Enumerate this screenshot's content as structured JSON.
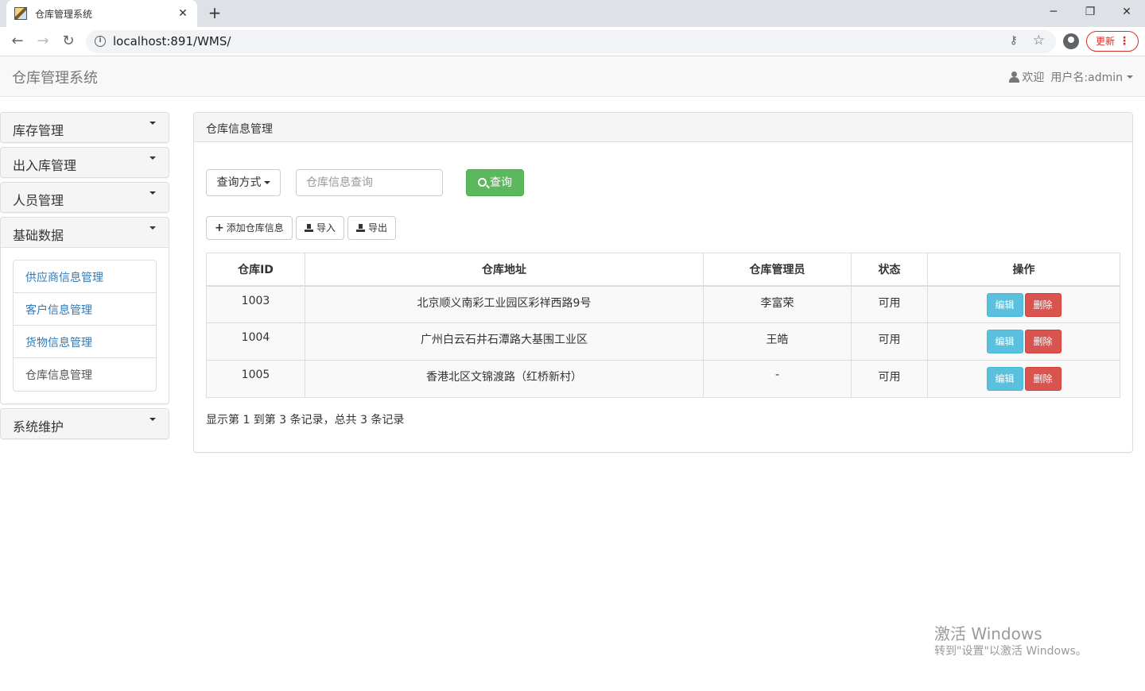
{
  "browser": {
    "tab_title": "仓库管理系统",
    "tab_close": "✕",
    "new_tab": "+",
    "url": "localhost:891/WMS/",
    "update_label": "更新",
    "window_controls": {
      "minimize": "─",
      "restore": "❐",
      "close": "✕"
    }
  },
  "navbar": {
    "brand": "仓库管理系统",
    "welcome": "欢迎",
    "username": "用户名:admin"
  },
  "sidebar": {
    "sections": [
      {
        "label": "库存管理"
      },
      {
        "label": "出入库管理"
      },
      {
        "label": "人员管理"
      },
      {
        "label": "基础数据"
      },
      {
        "label": "系统维护"
      }
    ],
    "basic_data_items": [
      {
        "label": "供应商信息管理"
      },
      {
        "label": "客户信息管理"
      },
      {
        "label": "货物信息管理"
      },
      {
        "label": "仓库信息管理"
      }
    ]
  },
  "main": {
    "panel_title": "仓库信息管理",
    "query_mode_label": "查询方式",
    "search_placeholder": "仓库信息查询",
    "search_button": "查询",
    "add_button": "添加仓库信息",
    "import_button": "导入",
    "export_button": "导出",
    "table": {
      "columns": [
        "仓库ID",
        "仓库地址",
        "仓库管理员",
        "状态",
        "操作"
      ],
      "rows": [
        {
          "id": "1003",
          "address": "北京顺义南彩工业园区彩祥西路9号",
          "manager": "李富荣",
          "status": "可用"
        },
        {
          "id": "1004",
          "address": "广州白云石井石潭路大基围工业区",
          "manager": "王皓",
          "status": "可用"
        },
        {
          "id": "1005",
          "address": "香港北区文锦渡路（红桥新村）",
          "manager": "-",
          "status": "可用"
        }
      ],
      "edit_label": "编辑",
      "delete_label": "删除"
    },
    "summary": "显示第 1 到第 3 条记录，总共 3 条记录"
  },
  "watermark": {
    "title": "激活 Windows",
    "subtitle": "转到\"设置\"以激活 Windows。"
  }
}
